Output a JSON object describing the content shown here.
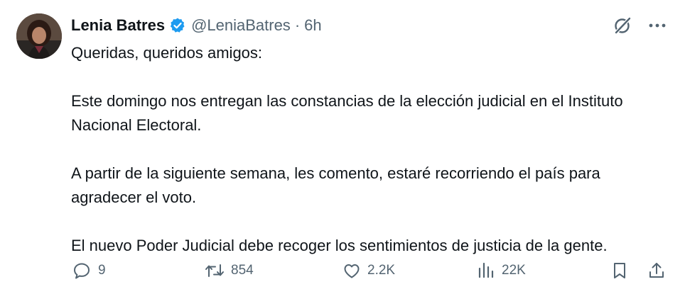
{
  "author": {
    "name": "Lenia Batres",
    "handle": "@LeniaBatres",
    "separator": "·",
    "time": "6h",
    "verified": true
  },
  "tweet": {
    "paragraphs": [
      "Queridas, queridos amigos:",
      "Este domingo nos entregan las constancias de la elección judicial en el Instituto Nacional Electoral.",
      "A partir de la siguiente semana, les comento, estaré recorriendo el país para agradecer el voto.",
      "El nuevo Poder Judicial debe recoger los sentimientos de justicia de la gente."
    ]
  },
  "actions": {
    "replies": "9",
    "reposts": "854",
    "likes": "2.2K",
    "views": "22K"
  },
  "colors": {
    "text": "#0f1419",
    "muted": "#536471",
    "verified_badge": "#1d9bf0"
  },
  "icons": [
    "grok-icon",
    "more-icon",
    "reply-icon",
    "retweet-icon",
    "like-icon",
    "views-icon",
    "bookmark-icon",
    "share-icon"
  ]
}
